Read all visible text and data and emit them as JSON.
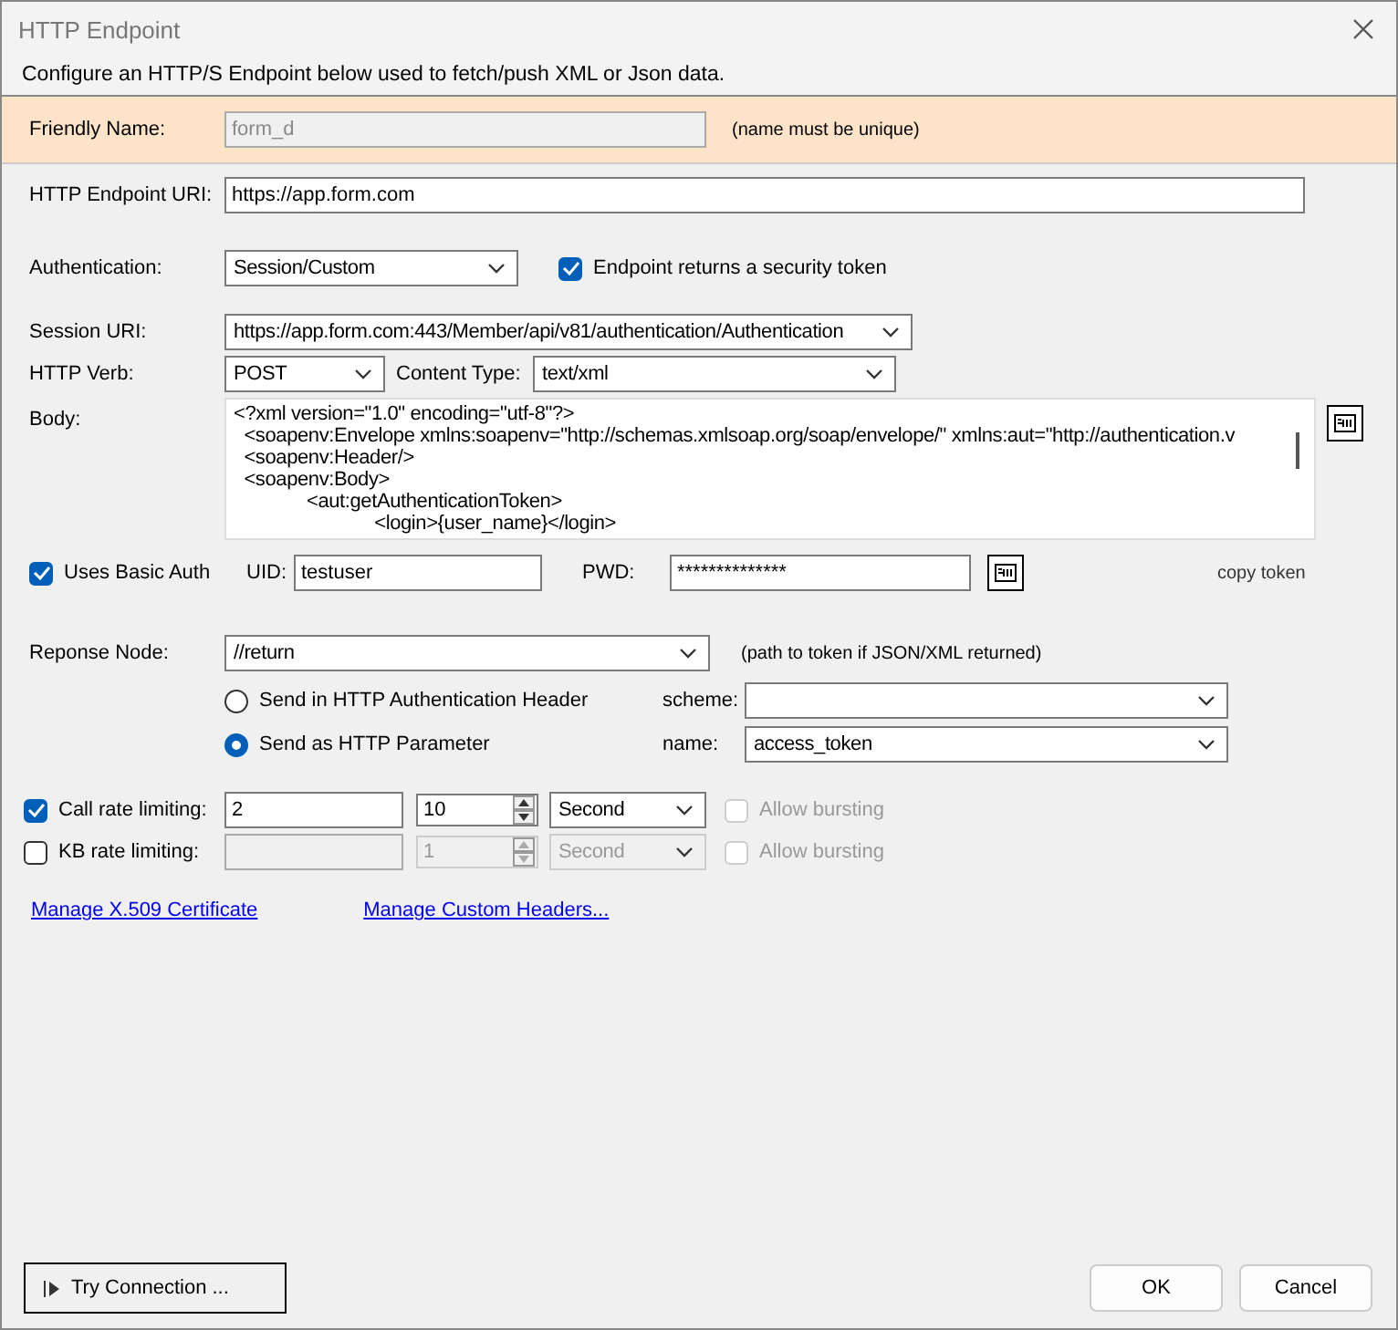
{
  "window": {
    "title": "HTTP Endpoint"
  },
  "description": "Configure an HTTP/S Endpoint below used to fetch/push XML or Json data.",
  "friendly_name": {
    "label": "Friendly Name:",
    "value": "form_d",
    "disabled": true,
    "hint": "(name must be unique)"
  },
  "endpoint_uri": {
    "label": "HTTP Endpoint URI:",
    "value": "https://app.form.com"
  },
  "authentication": {
    "label": "Authentication:",
    "value": "Session/Custom",
    "returns_token": {
      "label": "Endpoint returns a security token",
      "checked": true
    }
  },
  "session_uri": {
    "label": "Session URI:",
    "value": "https://app.form.com:443/Member/api/v81/authentication/Authentication"
  },
  "http_verb": {
    "label": "HTTP Verb:",
    "value": "POST"
  },
  "content_type": {
    "label": "Content Type:",
    "value": "text/xml"
  },
  "body": {
    "label": "Body:",
    "lines": [
      "<?xml version=\"1.0\" encoding=\"utf-8\"?>",
      "  <soapenv:Envelope xmlns:soapenv=\"http://schemas.xmlsoap.org/soap/envelope/\" xmlns:aut=\"http://authentication.v",
      "  <soapenv:Header/>",
      "  <soapenv:Body>",
      "              <aut:getAuthenticationToken>",
      "                           <login>{user_name}</login>"
    ]
  },
  "basic_auth": {
    "label": "Uses Basic Auth",
    "checked": true,
    "uid_label": "UID:",
    "uid": "testuser",
    "pwd_label": "PWD:",
    "pwd": "**************",
    "copy_token": "copy token"
  },
  "response_node": {
    "label": "Reponse Node:",
    "value": "//return",
    "hint": "(path to token if JSON/XML returned)"
  },
  "send_options": [
    {
      "label": "Send in HTTP Authentication Header",
      "selected": false,
      "field_label": "scheme:"
    },
    {
      "label": "Send as HTTP Parameter",
      "selected": true,
      "field_label": "name:",
      "field_value": "access_token"
    }
  ],
  "rate_limits": [
    {
      "label": "Call rate limiting:",
      "checked": true,
      "disabled": false,
      "amount": "2",
      "interval": "10",
      "unit": "Second",
      "bursting": {
        "label": "Allow bursting",
        "checked": false
      }
    },
    {
      "label": "KB rate limiting:",
      "checked": false,
      "disabled": true,
      "interval": "1",
      "unit": "Second",
      "bursting": {
        "label": "Allow bursting",
        "checked": false
      }
    }
  ],
  "links": [
    "Manage X.509 Certificate",
    "Manage Custom Headers..."
  ],
  "buttons": {
    "try": "Try Connection ...",
    "ok": "OK",
    "cancel": "Cancel"
  }
}
